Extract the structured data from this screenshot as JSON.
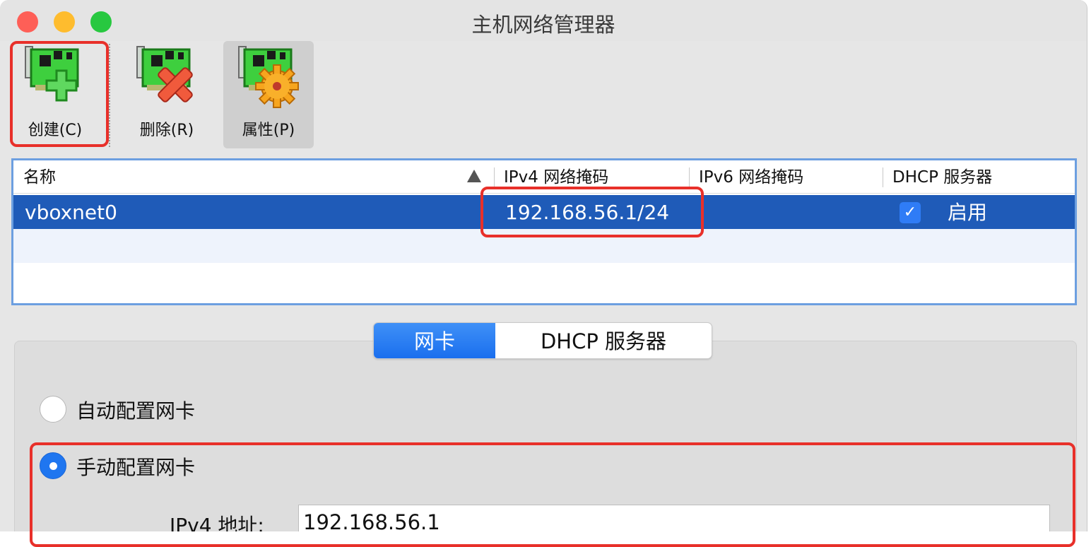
{
  "window": {
    "title": "主机网络管理器"
  },
  "toolbar": {
    "create_label": "创建(C)",
    "remove_label": "删除(R)",
    "properties_label": "属性(P)"
  },
  "table": {
    "headers": [
      "名称",
      "IPv4 网络掩码",
      "IPv6 网络掩码",
      "DHCP 服务器"
    ],
    "rows": [
      {
        "name": "vboxnet0",
        "ipv4": "192.168.56.1/24",
        "ipv6": "",
        "dhcp_checked": true,
        "dhcp_label": "启用"
      }
    ]
  },
  "tabs": {
    "nic": "网卡",
    "dhcp": "DHCP 服务器",
    "selected": "网卡"
  },
  "nic_config": {
    "auto_label": "自动配置网卡",
    "manual_label": "手动配置网卡",
    "selected": "manual",
    "ipv4_address_label": "IPv4 地址:",
    "ipv4_address_value": "192.168.56.1"
  },
  "colors": {
    "selection": "#1f5bb8",
    "accent": "#1f76f0",
    "annotation": "#e8302a"
  },
  "icons": {
    "check": "✓"
  }
}
